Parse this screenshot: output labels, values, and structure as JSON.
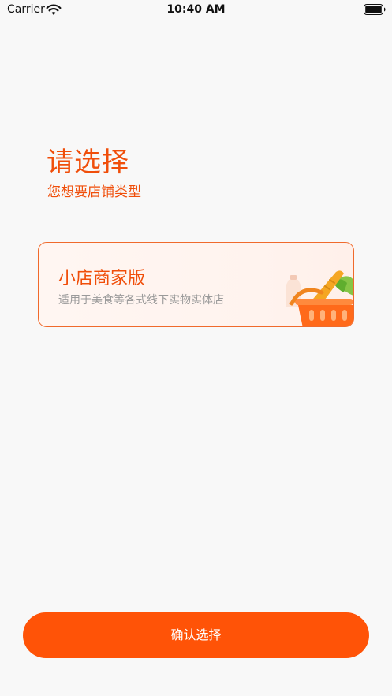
{
  "status_bar": {
    "carrier": "Carrier",
    "time": "10:40 AM",
    "icons": [
      "wifi-icon",
      "battery-icon"
    ]
  },
  "header": {
    "title": "请选择",
    "subtitle": "您想要店铺类型"
  },
  "store_types": [
    {
      "title": "小店商家版",
      "description": "适用于美食等各式线下实物实体店",
      "icon": "shopping-basket-icon",
      "selected": true
    }
  ],
  "confirm_button": {
    "label": "确认选择"
  },
  "colors": {
    "accent": "#f04e0a",
    "button": "#ff5307",
    "card_border": "#f06a2c",
    "card_background": "#fff4ef",
    "muted_text": "#9a9a9a",
    "background": "#f8f8f8"
  }
}
